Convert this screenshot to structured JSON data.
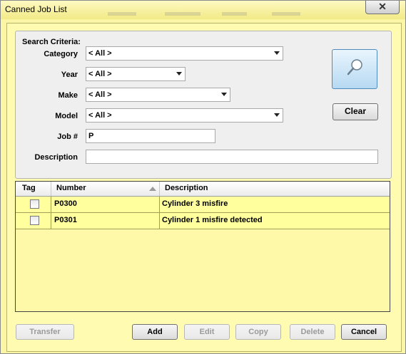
{
  "window": {
    "title": "Canned Job List",
    "close_glyph": "✕"
  },
  "criteria": {
    "section_label": "Search Criteria:",
    "category": {
      "label": "Category",
      "value": "< All >"
    },
    "year": {
      "label": "Year",
      "value": "< All >"
    },
    "make": {
      "label": "Make",
      "value": "< All >"
    },
    "model": {
      "label": "Model",
      "value": "< All >"
    },
    "job": {
      "label": "Job #",
      "value": "P"
    },
    "description": {
      "label": "Description",
      "value": ""
    },
    "clear_label": "Clear",
    "search_icon": "magnifier-icon"
  },
  "grid": {
    "headers": {
      "tag": "Tag",
      "number": "Number",
      "description": "Description"
    },
    "sort_column": "number",
    "rows": [
      {
        "tag": false,
        "number": "P0300",
        "description": "Cylinder 3 misfire"
      },
      {
        "tag": false,
        "number": "P0301",
        "description": "Cylinder 1 misfire detected"
      }
    ]
  },
  "footer": {
    "transfer": "Transfer",
    "add": "Add",
    "edit": "Edit",
    "copy": "Copy",
    "delete": "Delete",
    "cancel": "Cancel"
  },
  "colors": {
    "window_bg": "#fbf5a6",
    "grid_row": "#ffff9e",
    "search_button": "#b6d9f2"
  }
}
